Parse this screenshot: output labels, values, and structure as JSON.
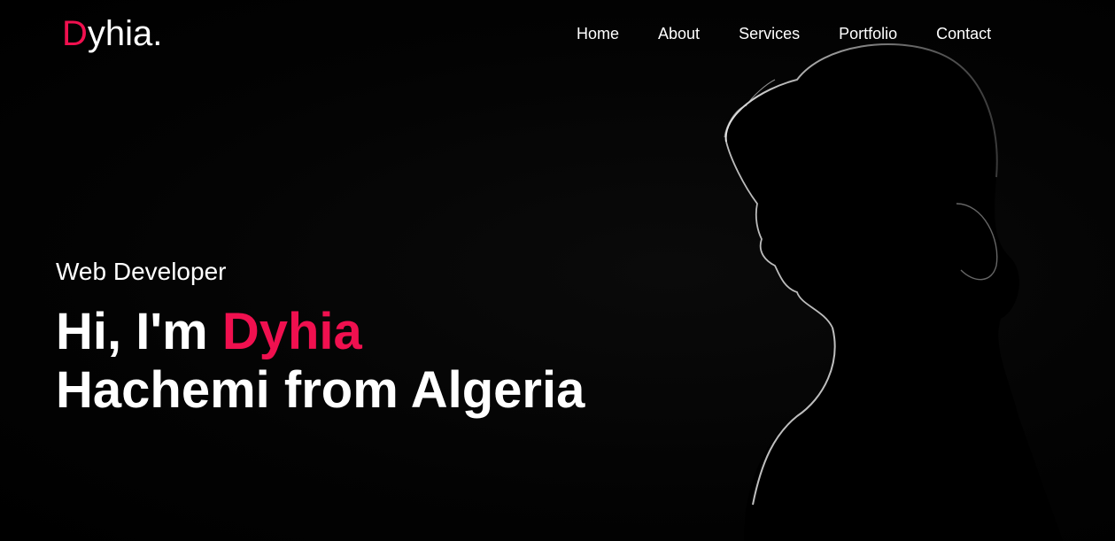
{
  "brand": {
    "logo_initial": "D",
    "logo_rest": "yhia.",
    "accent_color": "#f0104f"
  },
  "nav": {
    "items": [
      {
        "label": "Home"
      },
      {
        "label": "About"
      },
      {
        "label": "Services"
      },
      {
        "label": "Portfolio"
      },
      {
        "label": "Contact"
      }
    ]
  },
  "hero": {
    "subtitle": "Web Developer",
    "title_prefix": "Hi, I'm ",
    "title_name": "Dyhia",
    "title_line2": "Hachemi from Algeria"
  }
}
